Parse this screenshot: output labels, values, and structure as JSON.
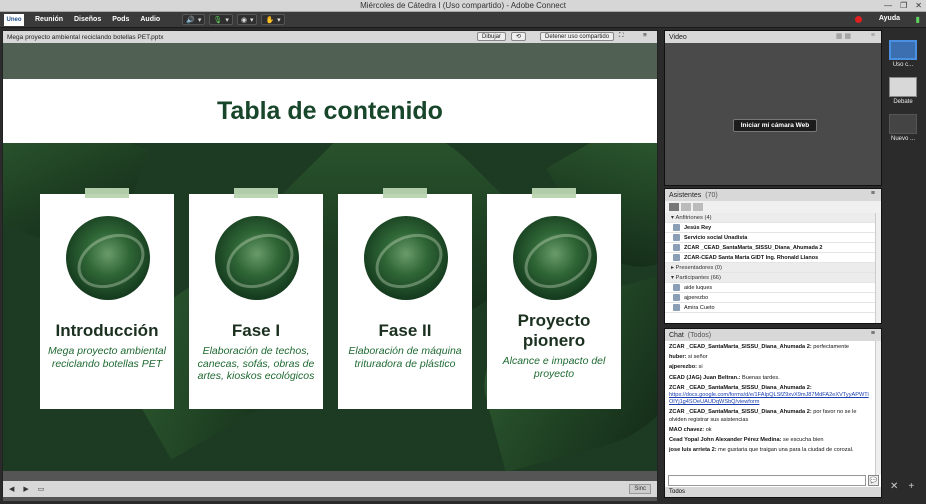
{
  "window": {
    "title": "Miércoles de Cátedra I (Uso compartido) - Adobe Connect"
  },
  "menubar": {
    "logo": "Uneo",
    "items": [
      "Reunión",
      "Diseños",
      "Pods",
      "Audio"
    ],
    "help": "Ayuda"
  },
  "share": {
    "file": "Mega proyecto ambiental reciclando botellas PET.pptx",
    "draw_label": "Dibujar",
    "stop_label": "Detener uso compartido",
    "sync_label": "Sinc",
    "slide": {
      "title": "Tabla de contenido",
      "cards": [
        {
          "title": "Introducción",
          "subtitle": "Mega proyecto ambiental reciclando botellas PET"
        },
        {
          "title": "Fase I",
          "subtitle": "Elaboración de techos, canecas, sofás, obras de artes, kioskos ecológicos"
        },
        {
          "title": "Fase II",
          "subtitle": "Elaboración de máquina trituradora de plástico"
        },
        {
          "title": "Proyecto pionero",
          "subtitle": "Alcance e impacto del proyecto"
        }
      ]
    }
  },
  "video": {
    "title": "Video",
    "webcam_button": "Iniciar mi cámara Web"
  },
  "attendees": {
    "title": "Asistentes",
    "count": "(70)",
    "hosts_label": "Anfitriones (4)",
    "hosts": [
      "Jesús Rey",
      "Servicio social Unadista",
      "ZCAR _CEAD_SantaMarta_SISSU_Diana_Ahumada 2",
      "ZCAR-CEAD Santa Marta GIDT Ing. Rhonald Llanos"
    ],
    "presenters_label": "Presentadores (0)",
    "participants_label": "Participantes (66)",
    "participants": [
      "aide luques",
      "ajperezbo",
      "Amira Cueto"
    ]
  },
  "chat": {
    "title": "Chat",
    "scope": "(Todos)",
    "messages": [
      {
        "sender": "ZCAR _CEAD_SantaMarta_SISSU_Diana_Ahumada 2:",
        "text": "perfectamente"
      },
      {
        "sender": "huber:",
        "text": "si señor"
      },
      {
        "sender": "ajperezbo:",
        "text": "si"
      },
      {
        "sender": "CEAD (JAG) Juan Beltran.:",
        "text": "Buenas tardes."
      },
      {
        "sender": "ZCAR _CEAD_SantaMarta_SISSU_Diana_Ahumada 2:",
        "text": "",
        "link": "https://docs.google.com/forms/d/e/1FAIpQLSfZ9xvX9mJ87MdFA2eXVTyyAPWTiOlYj1g4SOeUAUDqWSbQ/viewform"
      },
      {
        "sender": "ZCAR _CEAD_SantaMarta_SISSU_Diana_Ahumada 2:",
        "text": "por favor no se le olviden registrar sus asistencias"
      },
      {
        "sender": "MAO chavez:",
        "text": "ok"
      },
      {
        "sender": "Cead Yopal John Alexander Pérez Medina:",
        "text": "se escucha bien"
      },
      {
        "sender": "jose luis arrieta 2:",
        "text": "me gustaria que traigan una para la ciudad de corozal."
      }
    ],
    "tab": "Todos"
  },
  "layouts": [
    {
      "label": "Uso c...",
      "selected": true
    },
    {
      "label": "Debate",
      "selected": false
    },
    {
      "label": "Nuevo ...",
      "selected": false
    }
  ]
}
